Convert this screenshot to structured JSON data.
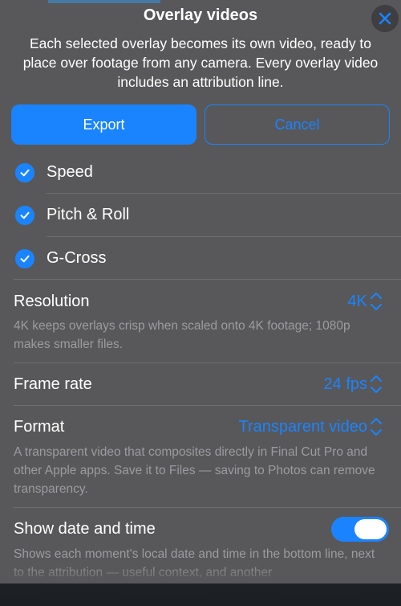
{
  "sheet": {
    "title": "Overlay videos",
    "subtitle": "Each selected overlay becomes its own video, ready to place over footage from any camera. Every overlay video includes an attribution line."
  },
  "buttons": {
    "export_label": "Export",
    "cancel_label": "Cancel"
  },
  "overlays": [
    {
      "label": "Speed",
      "checked": true
    },
    {
      "label": "Pitch & Roll",
      "checked": true
    },
    {
      "label": "G-Cross",
      "checked": true
    }
  ],
  "settings": {
    "resolution": {
      "label": "Resolution",
      "value": "4K",
      "description": "4K keeps overlays crisp when scaled onto 4K footage; 1080p makes smaller files."
    },
    "frame_rate": {
      "label": "Frame rate",
      "value": "24 fps"
    },
    "format": {
      "label": "Format",
      "value": "Transparent video",
      "description": "A transparent video that composites directly in Final Cut Pro and other Apple apps. Save it to Files — saving to Photos can remove transparency."
    },
    "show_date_time": {
      "label": "Show date and time",
      "enabled": true,
      "description": "Shows each moment's local date and time in the bottom line, next to the attribution — useful context, and another"
    }
  },
  "colors": {
    "accent": "#1a84ff",
    "sheet_background": "#58585a",
    "secondary_text": "#9b9ba0"
  },
  "icons": {
    "close": "close-icon",
    "check": "checkmark-icon",
    "stepper": "chevron-up-down-icon"
  }
}
